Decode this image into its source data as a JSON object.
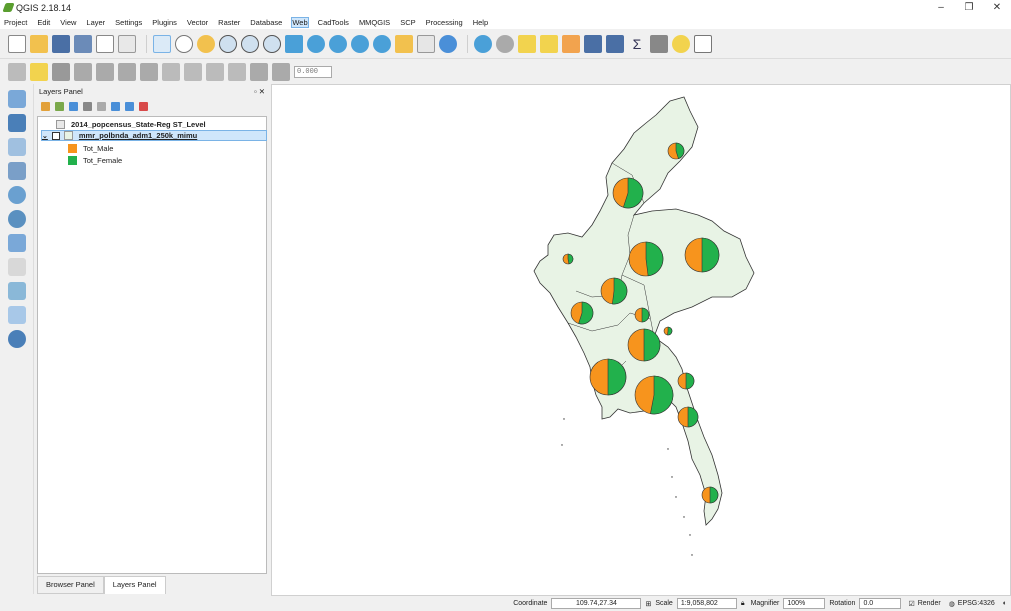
{
  "app": {
    "title": "QGIS 2.18.14"
  },
  "window_controls": {
    "minimize": "–",
    "restore": "❐",
    "close": "✕"
  },
  "menu": [
    "Project",
    "Edit",
    "View",
    "Layer",
    "Settings",
    "Plugins",
    "Vector",
    "Raster",
    "Database",
    "Web",
    "CadTools",
    "MMQGIS",
    "SCP",
    "Processing",
    "Help"
  ],
  "toolbar2": {
    "spin_value": "0.000"
  },
  "layers_panel": {
    "title": "Layers Panel",
    "layers": [
      {
        "name": "2014_popcensus_State-Reg ST_Level"
      },
      {
        "name": "mmr_polbnda_adm1_250k_mimu"
      }
    ],
    "legend": [
      {
        "label": "Tot_Male",
        "color": "#f7941d"
      },
      {
        "label": "Tot_Female",
        "color": "#22b14c"
      }
    ],
    "tabs": [
      "Browser Panel",
      "Layers Panel"
    ]
  },
  "map": {
    "fill": "#e8f3e5",
    "pies": [
      {
        "female_fraction": 0.45
      },
      {
        "female_fraction": 0.55
      },
      {
        "female_fraction": 0.48
      },
      {
        "female_fraction": 0.5
      },
      {
        "female_fraction": 0.47
      },
      {
        "female_fraction": 0.52
      },
      {
        "female_fraction": 0.55
      },
      {
        "female_fraction": 0.5
      },
      {
        "female_fraction": 0.52
      },
      {
        "female_fraction": 0.5
      },
      {
        "female_fraction": 0.5
      },
      {
        "female_fraction": 0.53
      },
      {
        "female_fraction": 0.5
      },
      {
        "female_fraction": 0.5
      },
      {
        "female_fraction": 0.5
      }
    ]
  },
  "status": {
    "coordinate_label": "Coordinate",
    "coordinate_value": "109.74,27.34",
    "scale_label": "Scale",
    "scale_value": "1:9,058,802",
    "magnifier_label": "Magnifier",
    "magnifier_value": "100%",
    "rotation_label": "Rotation",
    "rotation_value": "0.0",
    "render_label": "Render",
    "crs_label": "EPSG:4326"
  }
}
